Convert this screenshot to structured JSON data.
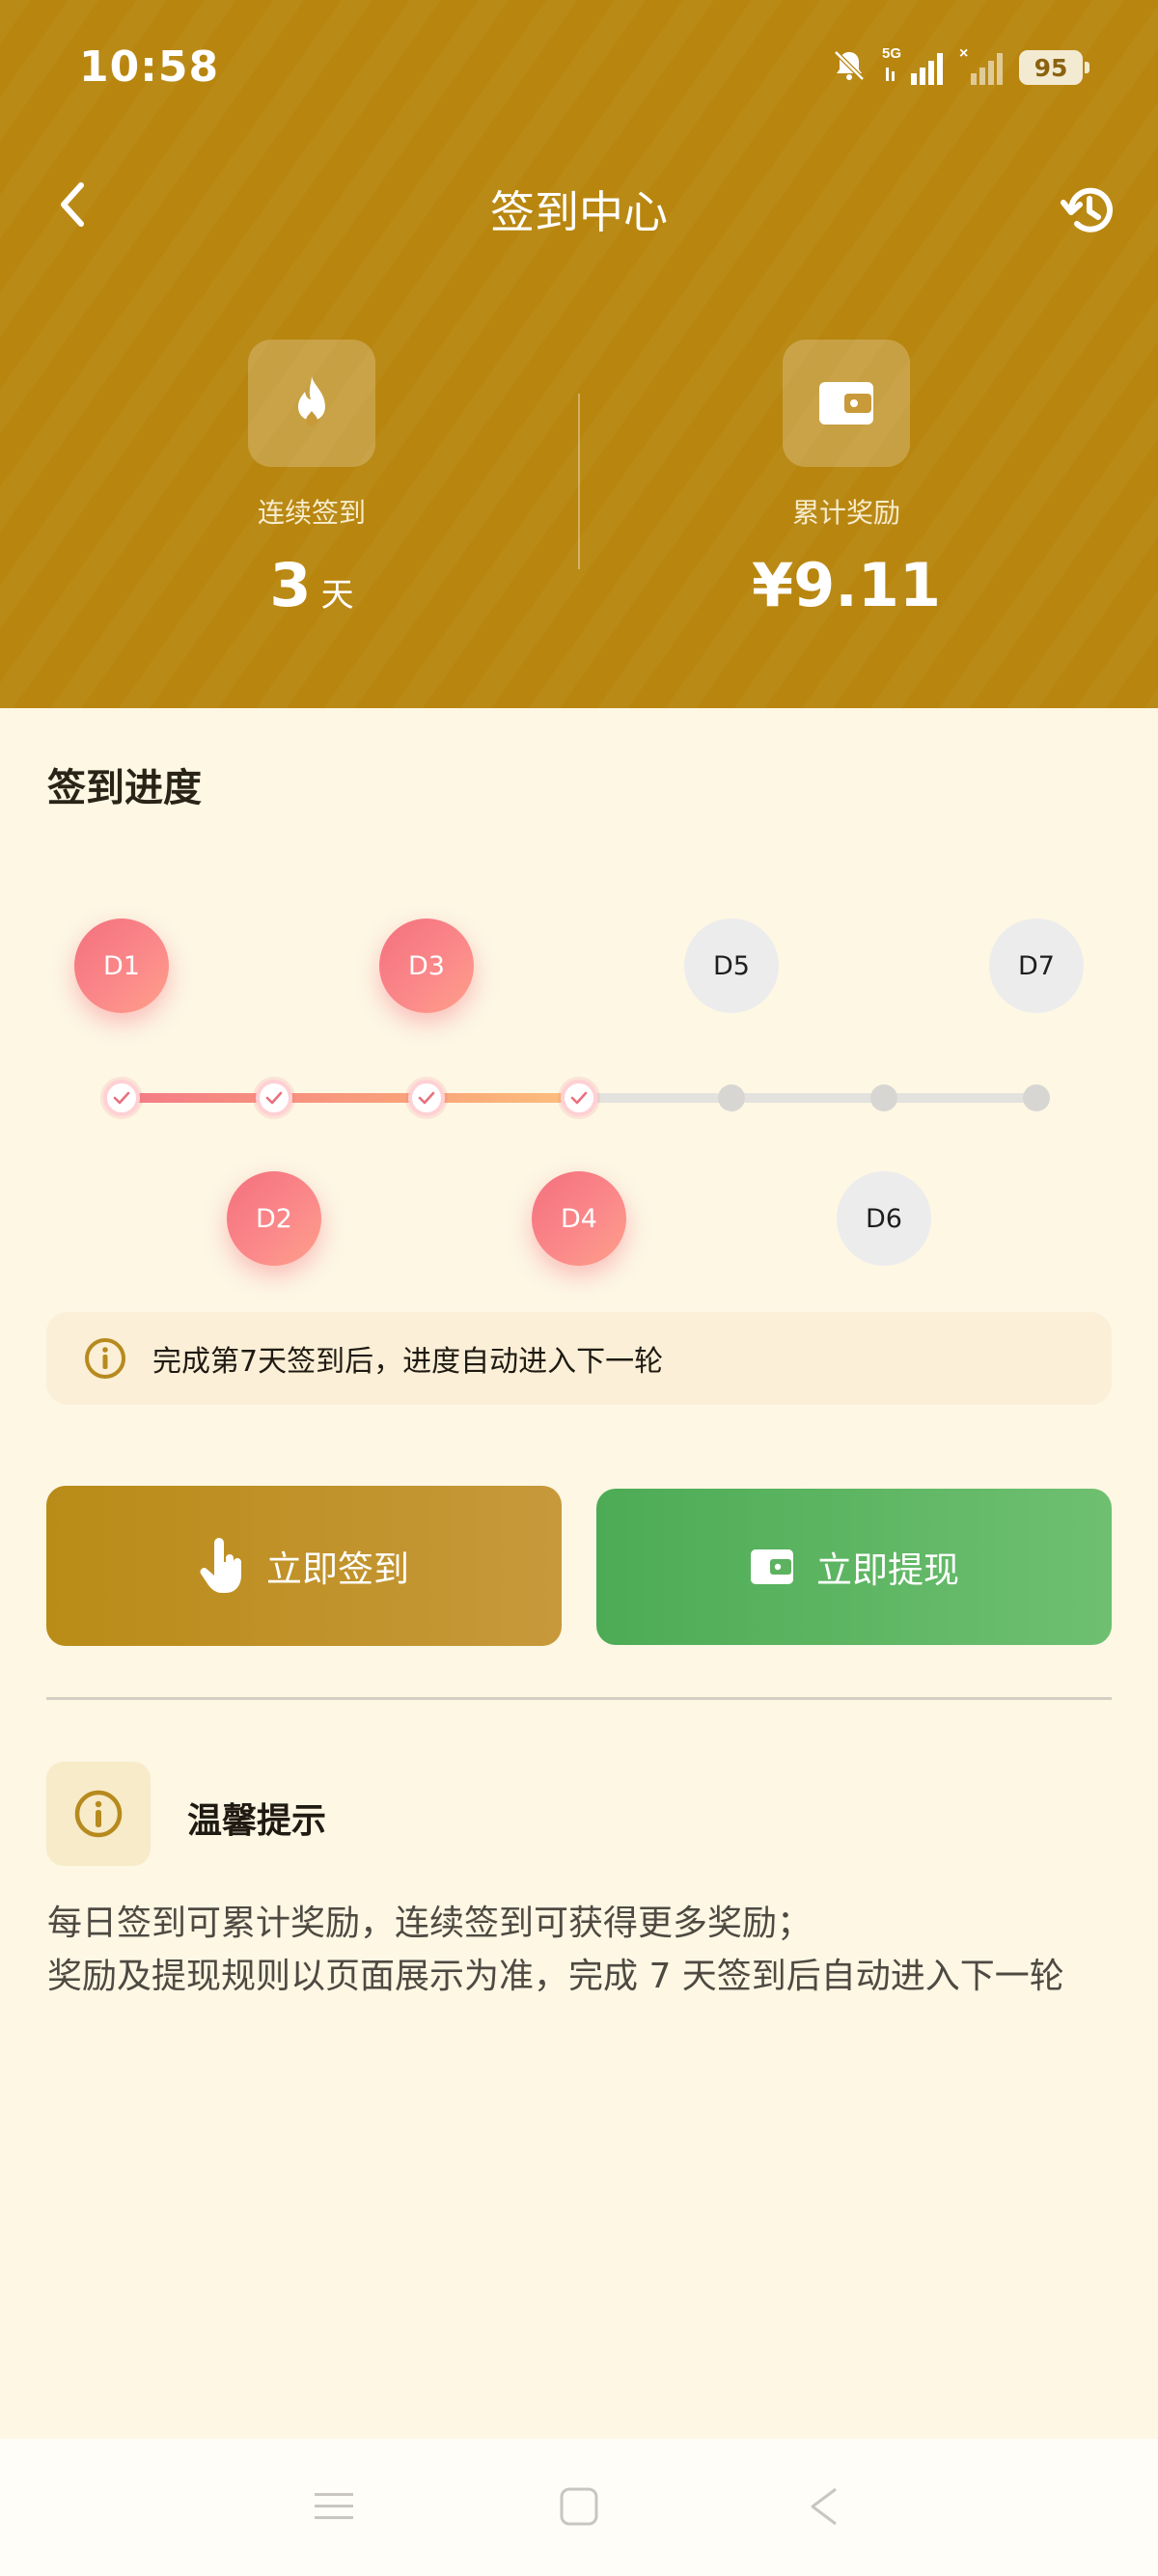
{
  "status_bar": {
    "time": "10:58",
    "network": "5G",
    "battery": "95"
  },
  "header": {
    "title": "签到中心",
    "back_icon": "chevron-left-icon",
    "history_icon": "history-icon"
  },
  "stats": {
    "streak": {
      "label": "连续签到",
      "value": "3",
      "unit": "天",
      "icon": "flame-icon"
    },
    "reward": {
      "label": "累计奖励",
      "value": "¥9.11",
      "icon": "wallet-icon"
    }
  },
  "progress": {
    "title": "签到进度",
    "days": [
      {
        "label": "D1",
        "done": true
      },
      {
        "label": "D2",
        "done": true
      },
      {
        "label": "D3",
        "done": true
      },
      {
        "label": "D4",
        "done": true
      },
      {
        "label": "D5",
        "done": false
      },
      {
        "label": "D6",
        "done": false
      },
      {
        "label": "D7",
        "done": false
      }
    ],
    "completed_days": 4,
    "total_days": 7,
    "tip": "完成第7天签到后，进度自动进入下一轮"
  },
  "actions": {
    "signin_label": "立即签到",
    "withdraw_label": "立即提现"
  },
  "notice": {
    "title": "温馨提示",
    "line1": "每日签到可累计奖励，连续签到可获得更多奖励；",
    "line2": "奖励及提现规则以页面展示为准，完成 7 天签到后自动进入下一轮"
  },
  "colors": {
    "header_bg": "#b8860f",
    "page_bg": "#fdf7e4",
    "done_pink": "#f4707e",
    "green": "#4dab55",
    "gold": "#b98b17"
  }
}
